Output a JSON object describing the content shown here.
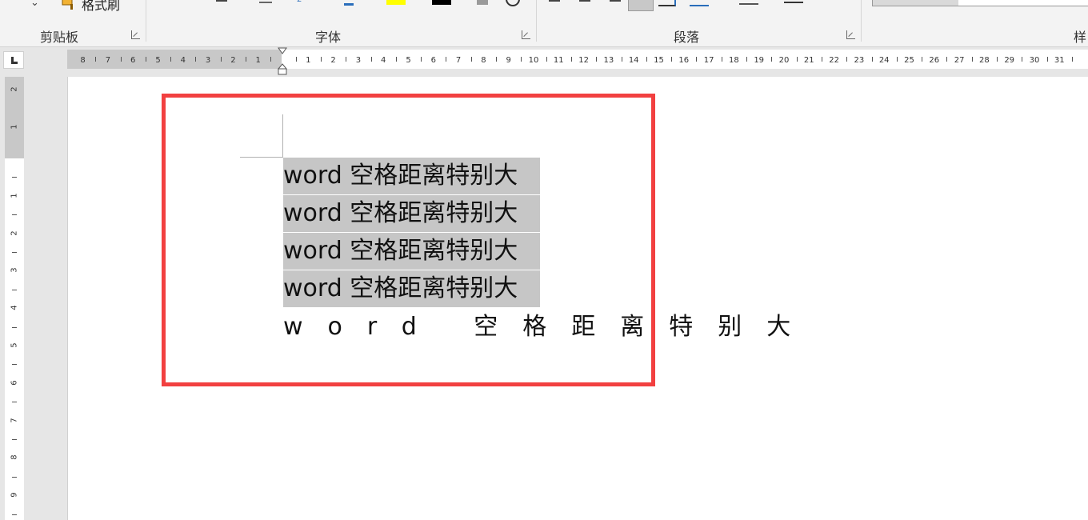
{
  "ribbon": {
    "groups": [
      {
        "id": "clipboard",
        "label": "剪贴板"
      },
      {
        "id": "font",
        "label": "字体"
      },
      {
        "id": "paragraph",
        "label": "段落"
      },
      {
        "id": "styles",
        "label": "样"
      }
    ],
    "format_painter_label": "格式刷",
    "font_color": "#000000",
    "highlight_color": "#ffff00"
  },
  "ruler": {
    "left_ticks": [
      "8",
      "7",
      "6",
      "5",
      "4",
      "3",
      "2",
      "1"
    ],
    "right_ticks": [
      "1",
      "2",
      "3",
      "4",
      "5",
      "6",
      "7",
      "8",
      "9",
      "10",
      "11",
      "12",
      "13",
      "14",
      "15",
      "16",
      "17",
      "18",
      "19",
      "20",
      "21",
      "22",
      "23",
      "24",
      "25",
      "26",
      "27",
      "28",
      "29",
      "30",
      "31"
    ],
    "vertical_top_ticks": [
      "2",
      "1"
    ],
    "vertical_ticks": [
      "1",
      "2",
      "3",
      "4",
      "5",
      "6",
      "7",
      "8",
      "9"
    ]
  },
  "document": {
    "lines": [
      "word 空格距离特别大",
      "word 空格距离特别大",
      "word 空格距离特别大",
      "word 空格距离特别大"
    ],
    "spaced_line": "word 空格距离特别大",
    "highlight_border_color": "#f24040",
    "selection_color": "#c6c6c6"
  }
}
